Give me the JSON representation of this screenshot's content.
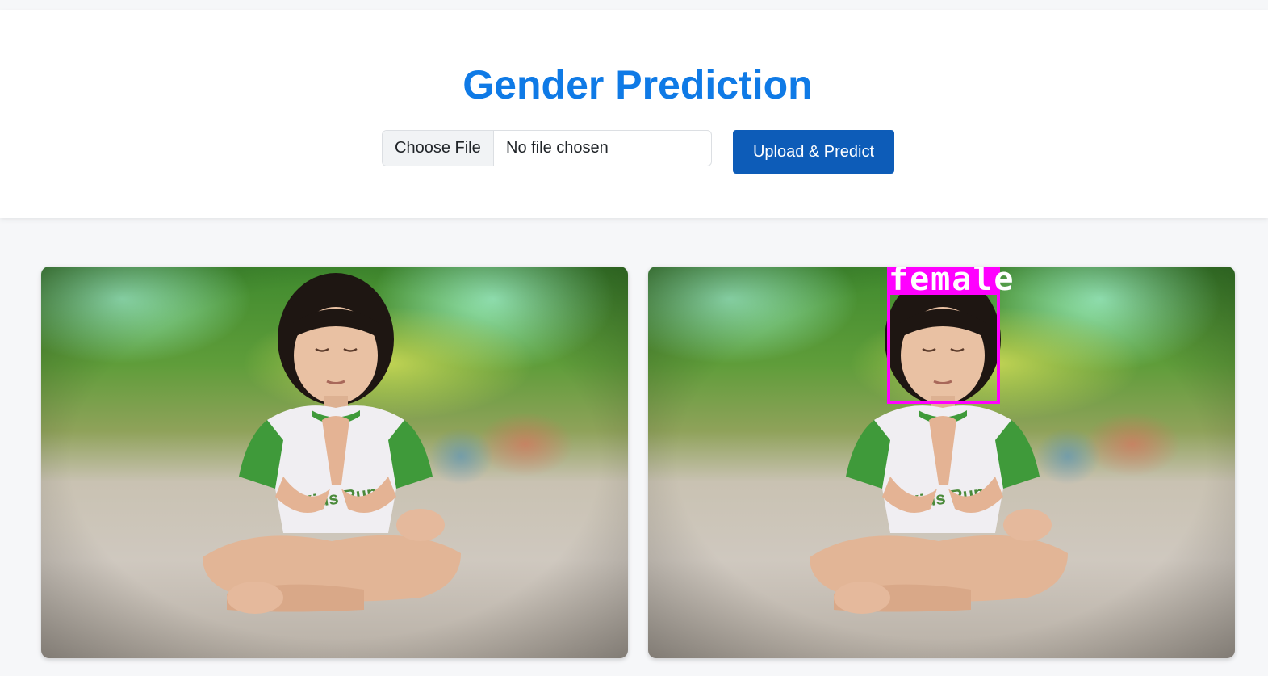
{
  "header": {
    "title": "Gender Prediction"
  },
  "upload_form": {
    "choose_file_label": "Choose File",
    "file_status": "No file chosen",
    "submit_label": "Upload & Predict"
  },
  "images": {
    "original_alt": "uploaded image",
    "result_alt": "prediction result"
  },
  "prediction": {
    "label": "female",
    "box_color": "#ff00ff"
  },
  "colors": {
    "title": "#0f7ae6",
    "button": "#0d5cb8",
    "background": "#f6f7f9"
  }
}
